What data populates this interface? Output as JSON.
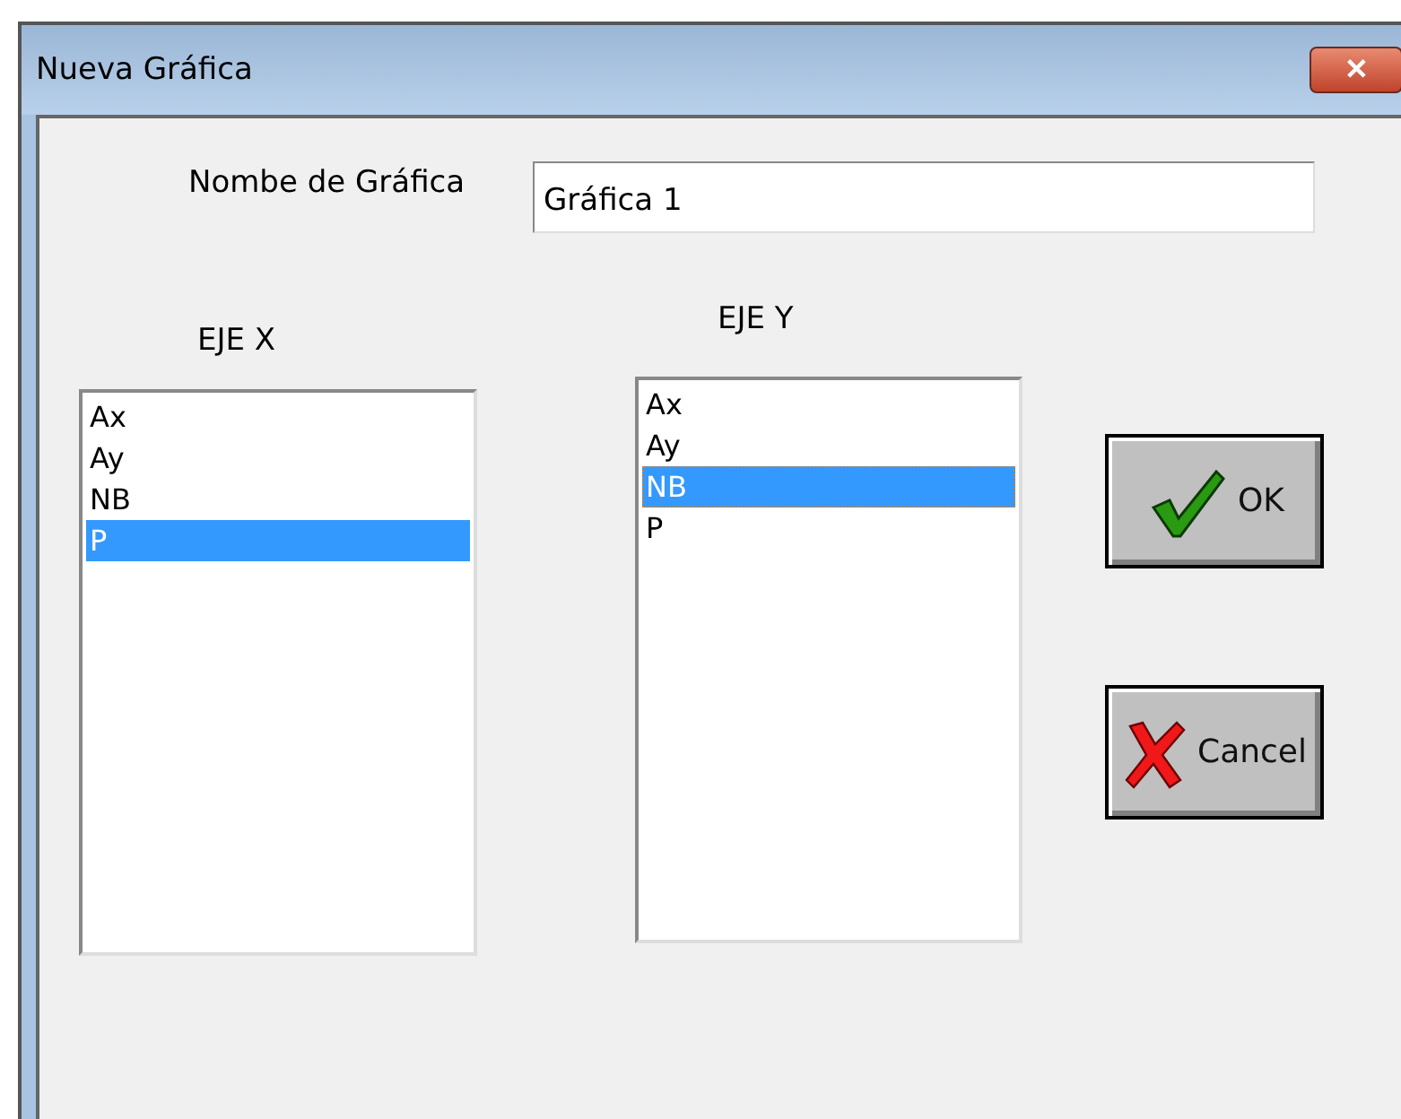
{
  "window": {
    "title": "Nueva Gráfica",
    "close": "✕"
  },
  "name_field": {
    "label": "Nombe de Gráfica",
    "value": "Gráfica 1"
  },
  "lists": [
    {
      "heading": "EJE X",
      "items": [
        {
          "label": "Ax",
          "selected": false
        },
        {
          "label": "Ay",
          "selected": false
        },
        {
          "label": "NB",
          "selected": false
        },
        {
          "label": "P",
          "selected": true
        }
      ]
    },
    {
      "heading": "EJE Y",
      "items": [
        {
          "label": "Ax",
          "selected": false
        },
        {
          "label": "Ay",
          "selected": false
        },
        {
          "label": "NB",
          "selected": true
        },
        {
          "label": "P",
          "selected": false
        }
      ]
    }
  ],
  "buttons": [
    {
      "label": "OK",
      "kind": "ok"
    },
    {
      "label": "Cancel",
      "kind": "cancel"
    }
  ]
}
